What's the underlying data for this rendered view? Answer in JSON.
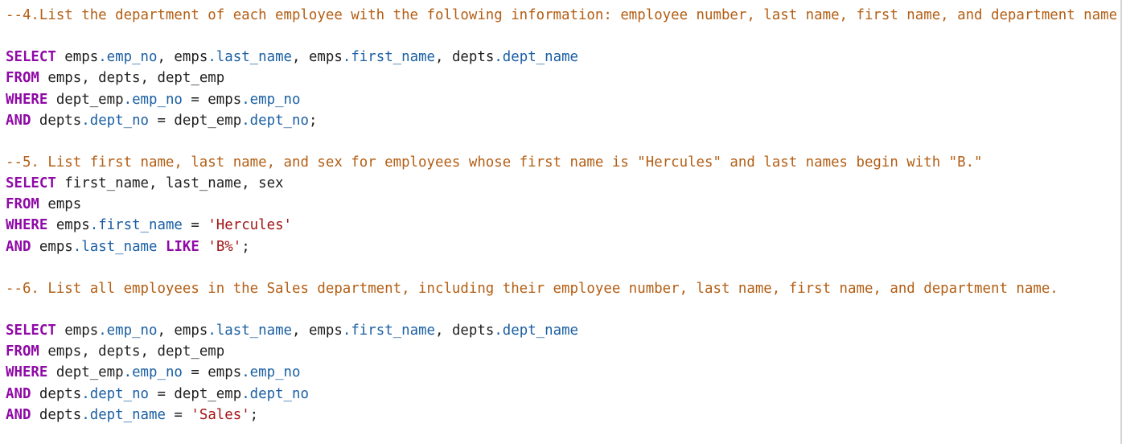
{
  "lines": [
    [
      {
        "t": "comment",
        "v": "--4.List the department of each employee with the following information: employee number, last name, first name, and department name"
      }
    ],
    [],
    [
      {
        "t": "keyword",
        "v": "SELECT"
      },
      {
        "t": "plain",
        "v": " emps"
      },
      {
        "t": "prop",
        "v": ".emp_no"
      },
      {
        "t": "plain",
        "v": ", emps"
      },
      {
        "t": "prop",
        "v": ".last_name"
      },
      {
        "t": "plain",
        "v": ", emps"
      },
      {
        "t": "prop",
        "v": ".first_name"
      },
      {
        "t": "plain",
        "v": ", depts"
      },
      {
        "t": "prop",
        "v": ".dept_name"
      }
    ],
    [
      {
        "t": "keyword",
        "v": "FROM"
      },
      {
        "t": "plain",
        "v": " emps, depts, dept_emp"
      }
    ],
    [
      {
        "t": "keyword",
        "v": "WHERE"
      },
      {
        "t": "plain",
        "v": " dept_emp"
      },
      {
        "t": "prop",
        "v": ".emp_no"
      },
      {
        "t": "plain",
        "v": " = emps"
      },
      {
        "t": "prop",
        "v": ".emp_no"
      }
    ],
    [
      {
        "t": "keyword",
        "v": "AND"
      },
      {
        "t": "plain",
        "v": " depts"
      },
      {
        "t": "prop",
        "v": ".dept_no"
      },
      {
        "t": "plain",
        "v": " = dept_emp"
      },
      {
        "t": "prop",
        "v": ".dept_no"
      },
      {
        "t": "plain",
        "v": ";"
      }
    ],
    [],
    [
      {
        "t": "comment",
        "v": "--5. List first name, last name, and sex for employees whose first name is \"Hercules\" and last names begin with \"B.\""
      }
    ],
    [
      {
        "t": "keyword",
        "v": "SELECT"
      },
      {
        "t": "plain",
        "v": " first_name, last_name, sex"
      }
    ],
    [
      {
        "t": "keyword",
        "v": "FROM"
      },
      {
        "t": "plain",
        "v": " emps"
      }
    ],
    [
      {
        "t": "keyword",
        "v": "WHERE"
      },
      {
        "t": "plain",
        "v": " emps"
      },
      {
        "t": "prop",
        "v": ".first_name"
      },
      {
        "t": "plain",
        "v": " = "
      },
      {
        "t": "string",
        "v": "'Hercules'"
      }
    ],
    [
      {
        "t": "keyword",
        "v": "AND"
      },
      {
        "t": "plain",
        "v": " emps"
      },
      {
        "t": "prop",
        "v": ".last_name"
      },
      {
        "t": "plain",
        "v": " "
      },
      {
        "t": "keyword",
        "v": "LIKE"
      },
      {
        "t": "plain",
        "v": " "
      },
      {
        "t": "string",
        "v": "'B%'"
      },
      {
        "t": "plain",
        "v": ";"
      }
    ],
    [],
    [
      {
        "t": "comment",
        "v": "--6. List all employees in the Sales department, including their employee number, last name, first name, and department name."
      }
    ],
    [],
    [
      {
        "t": "keyword",
        "v": "SELECT"
      },
      {
        "t": "plain",
        "v": " emps"
      },
      {
        "t": "prop",
        "v": ".emp_no"
      },
      {
        "t": "plain",
        "v": ", emps"
      },
      {
        "t": "prop",
        "v": ".last_name"
      },
      {
        "t": "plain",
        "v": ", emps"
      },
      {
        "t": "prop",
        "v": ".first_name"
      },
      {
        "t": "plain",
        "v": ", depts"
      },
      {
        "t": "prop",
        "v": ".dept_name"
      }
    ],
    [
      {
        "t": "keyword",
        "v": "FROM"
      },
      {
        "t": "plain",
        "v": " emps, depts, dept_emp"
      }
    ],
    [
      {
        "t": "keyword",
        "v": "WHERE"
      },
      {
        "t": "plain",
        "v": " dept_emp"
      },
      {
        "t": "prop",
        "v": ".emp_no"
      },
      {
        "t": "plain",
        "v": " = emps"
      },
      {
        "t": "prop",
        "v": ".emp_no"
      }
    ],
    [
      {
        "t": "keyword",
        "v": "AND"
      },
      {
        "t": "plain",
        "v": " depts"
      },
      {
        "t": "prop",
        "v": ".dept_no"
      },
      {
        "t": "plain",
        "v": " = dept_emp"
      },
      {
        "t": "prop",
        "v": ".dept_no"
      }
    ],
    [
      {
        "t": "keyword",
        "v": "AND"
      },
      {
        "t": "plain",
        "v": " depts"
      },
      {
        "t": "prop",
        "v": ".dept_name"
      },
      {
        "t": "plain",
        "v": " = "
      },
      {
        "t": "string",
        "v": "'Sales'"
      },
      {
        "t": "plain",
        "v": ";"
      }
    ]
  ]
}
